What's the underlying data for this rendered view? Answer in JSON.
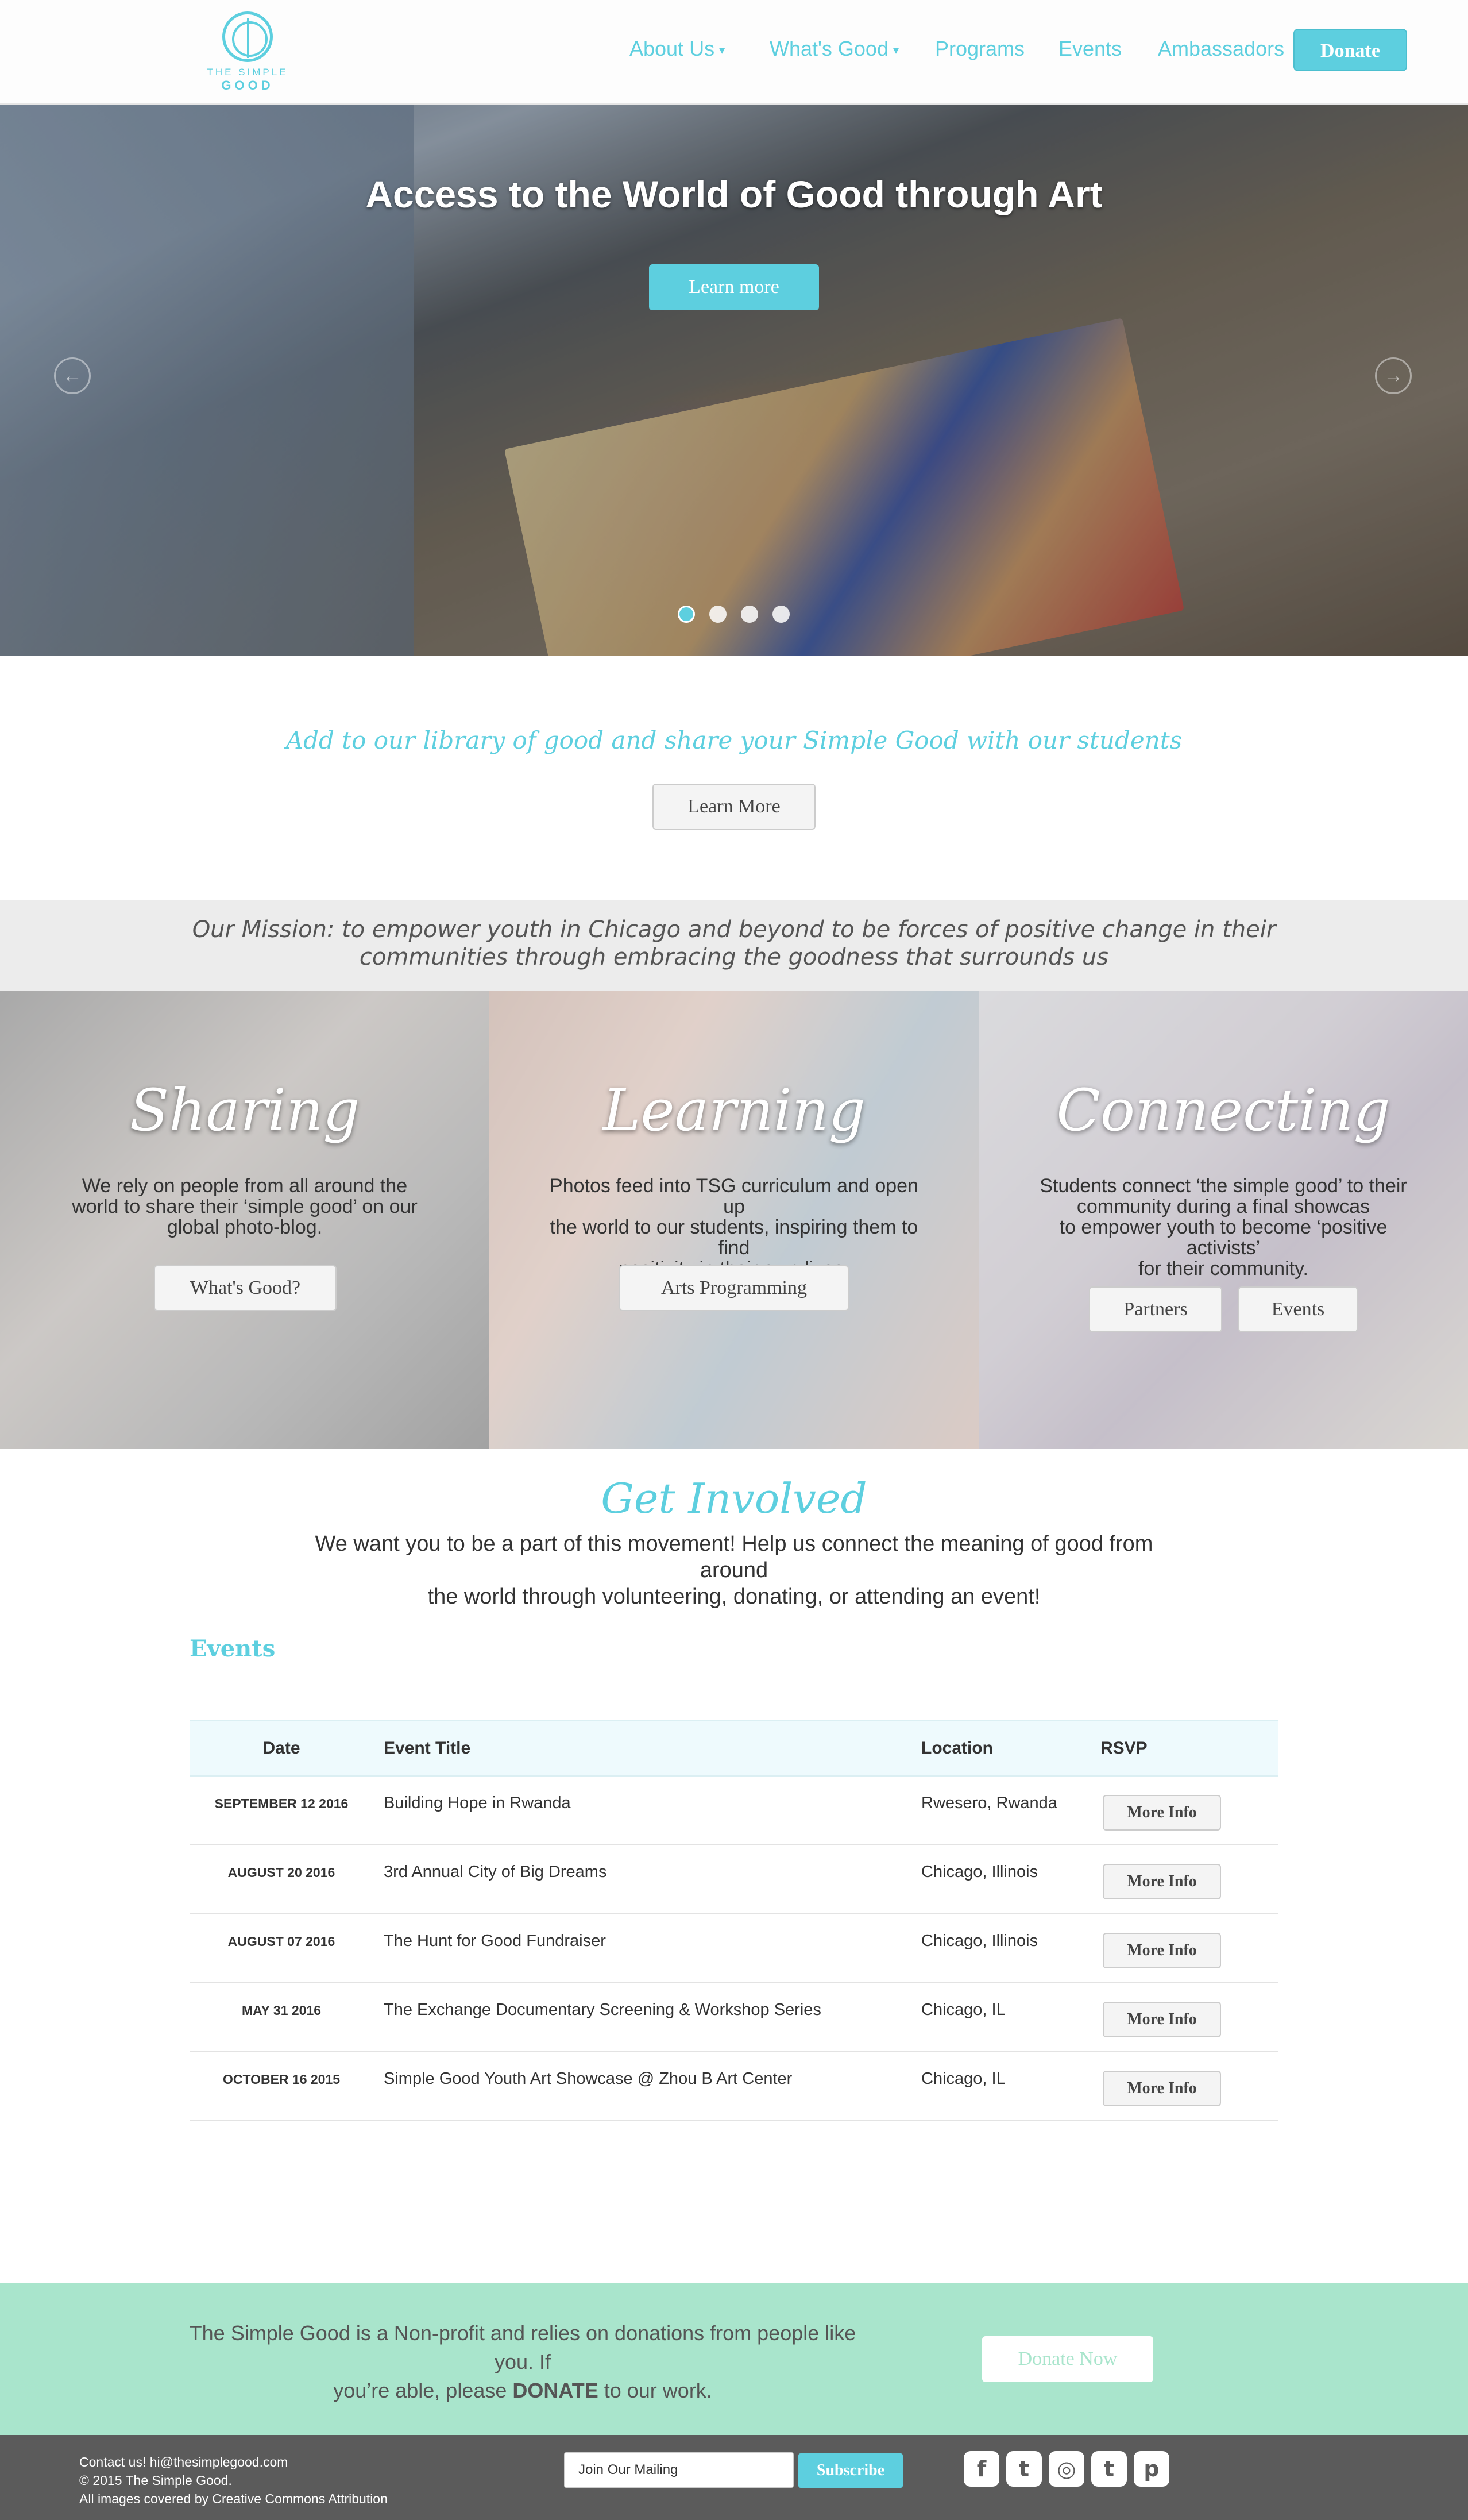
{
  "brand": {
    "line1": "THE SIMPLE",
    "line2": "GOOD"
  },
  "nav": {
    "items": [
      {
        "label": "About Us",
        "dropdown": true
      },
      {
        "label": "What's Good",
        "dropdown": true
      },
      {
        "label": "Programs",
        "dropdown": false
      },
      {
        "label": "Events",
        "dropdown": false
      },
      {
        "label": "Ambassadors",
        "dropdown": false
      }
    ],
    "donate_label": "Donate"
  },
  "hero": {
    "title": "Access to the World of Good through Art",
    "button_label": "Learn more",
    "prev_icon": "arrow-left-icon",
    "next_icon": "arrow-right-icon",
    "slides": 4,
    "active_slide": 1
  },
  "library": {
    "text": "Add to our library of good and share your Simple Good with our students",
    "button_label": "Learn More"
  },
  "mission": {
    "line1": "Our Mission: to empower youth in Chicago and beyond to be forces of positive change in their",
    "line2": "communities through embracing the goodness that surrounds us"
  },
  "panels": [
    {
      "title": "Sharing",
      "lines": [
        "We rely on people from all around the",
        "world to share their ‘simple good’ on our",
        "global photo-blog."
      ],
      "buttons": [
        "What's Good?"
      ]
    },
    {
      "title": "Learning",
      "lines": [
        "Photos feed into TSG curriculum and open up",
        "the world to our students, inspiring them to find",
        "positivity in their own lives."
      ],
      "buttons": [
        "Arts Programming"
      ]
    },
    {
      "title": "Connecting",
      "lines": [
        "Students connect ‘the simple good’ to their",
        "community during a final showcas",
        "to empower youth to become ‘positive activists’",
        "for their community."
      ],
      "buttons": [
        "Partners",
        "Events"
      ]
    }
  ],
  "get_involved": {
    "title": "Get Involved",
    "line1": "We want you to be a part of this movement! Help us connect the meaning of good from around",
    "line2": "the world through volunteering, donating, or attending an event!"
  },
  "events": {
    "heading": "Events",
    "columns": [
      "Date",
      "Event Title",
      "Location",
      "RSVP"
    ],
    "rows": [
      {
        "date": "SEPTEMBER 12 2016",
        "title": "Building Hope in Rwanda",
        "location": "Rwesero, Rwanda",
        "rsvp": "More Info"
      },
      {
        "date": "AUGUST 20 2016",
        "title": "3rd Annual City of Big Dreams",
        "location": "Chicago, Illinois",
        "rsvp": "More Info"
      },
      {
        "date": "AUGUST 07 2016",
        "title": "The Hunt for Good Fundraiser",
        "location": "Chicago, Illinois",
        "rsvp": "More Info"
      },
      {
        "date": "MAY 31 2016",
        "title": "The Exchange Documentary Screening & Workshop Series",
        "location": "Chicago, IL",
        "rsvp": "More Info"
      },
      {
        "date": "OCTOBER 16 2015",
        "title": "Simple Good Youth Art Showcase @ Zhou B Art Center",
        "location": "Chicago, IL",
        "rsvp": "More Info"
      }
    ]
  },
  "donate_band": {
    "line1": "The Simple Good is a Non-profit and relies on donations from people like you. If",
    "line2_pre": "you’re able, please ",
    "line2_bold": "DONATE",
    "line2_post": " to our work.",
    "button_label": "Donate Now"
  },
  "footer": {
    "contact": "Contact us! hi@thesimplegood.com",
    "copyright": "© 2015 The Simple Good.",
    "license": "All images covered by Creative Commons Attribution",
    "mail_placeholder": "Join Our Mailing",
    "subscribe_label": "Subscribe",
    "social": [
      {
        "icon": "facebook-icon",
        "glyph": "f"
      },
      {
        "icon": "twitter-icon",
        "glyph": "t"
      },
      {
        "icon": "instagram-icon",
        "glyph": "◎"
      },
      {
        "icon": "tumblr-icon",
        "glyph": "t"
      },
      {
        "icon": "pinterest-icon",
        "glyph": "p"
      }
    ]
  },
  "colors": {
    "accent": "#5dcfdf",
    "mint": "#a9e5cc",
    "footer": "#5b5b5b",
    "mission_bg": "#ececec"
  }
}
